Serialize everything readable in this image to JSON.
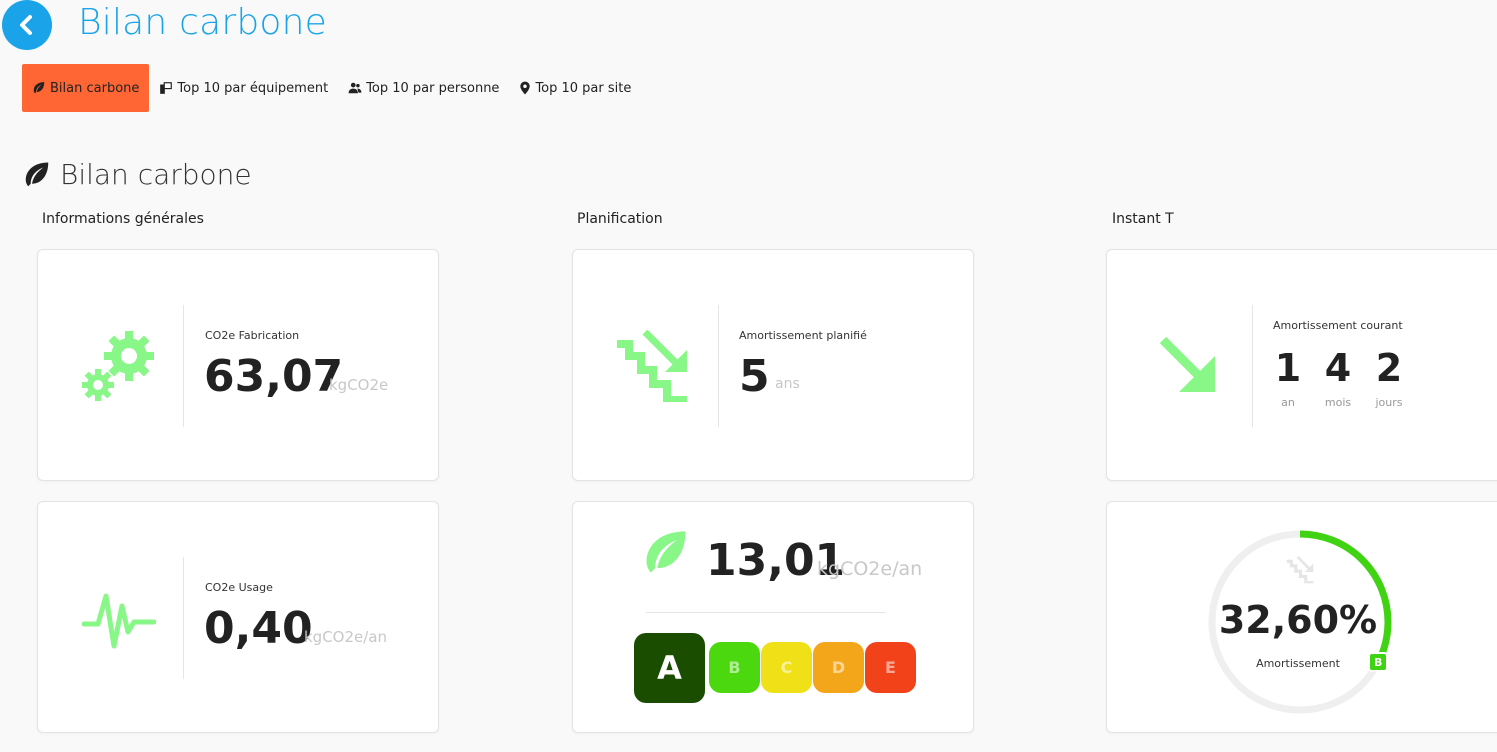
{
  "header": {
    "title": "Bilan carbone"
  },
  "tabs": [
    {
      "label": "Bilan carbone",
      "icon": "leaf-icon"
    },
    {
      "label": "Top 10 par équipement",
      "icon": "devices-icon"
    },
    {
      "label": "Top 10 par personne",
      "icon": "people-icon"
    },
    {
      "label": "Top 10 par site",
      "icon": "map-pin-icon"
    }
  ],
  "section": {
    "title": "Bilan carbone"
  },
  "columns": {
    "general": "Informations générales",
    "planning": "Planification",
    "instant": "Instant T"
  },
  "cards": {
    "fabrication": {
      "label": "CO2e Fabrication",
      "value": "63,07",
      "unit": "kgCO2e"
    },
    "usage": {
      "label": "CO2e Usage",
      "value": "0,40",
      "unit": "kgCO2e/an"
    },
    "amortissement_planifie": {
      "label": "Amortissement planifié",
      "value": "5",
      "unit": "ans"
    },
    "amortissement_courant": {
      "label": "Amortissement courant",
      "years": "1",
      "years_label": "an",
      "months": "4",
      "months_label": "mois",
      "days": "2",
      "days_label": "jours"
    },
    "annual": {
      "value": "13,01",
      "unit": "kgCO2e/an",
      "grades": [
        "A",
        "B",
        "C",
        "D",
        "E"
      ],
      "selected_grade": "A"
    },
    "gauge": {
      "value": "32,60%",
      "percent": 32.6,
      "label": "Amortissement",
      "badge": "B"
    }
  },
  "colors": {
    "accent": "#1aa3e8",
    "active_tab": "#ff6633",
    "icon_green": "#88f788",
    "grade_a": "#1b4d00",
    "grade_b": "#4cd80e",
    "grade_c": "#f0e017",
    "grade_d": "#f4a61a",
    "grade_e": "#f1421a",
    "gauge_green": "#3fd313"
  }
}
